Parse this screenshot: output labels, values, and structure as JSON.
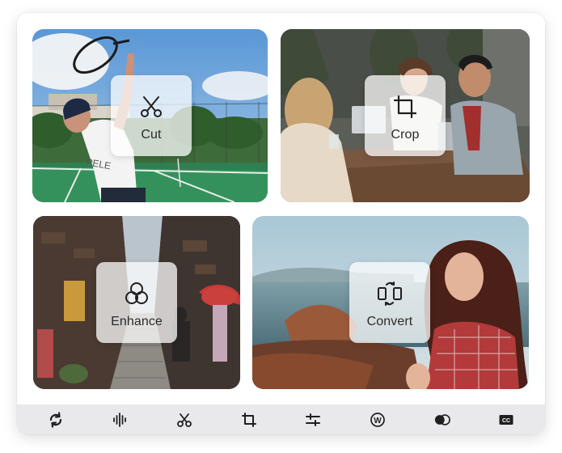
{
  "tools": [
    {
      "label": "Cut",
      "icon": "scissors-icon"
    },
    {
      "label": "Crop",
      "icon": "crop-icon"
    },
    {
      "label": "Enhance",
      "icon": "enhance-icon"
    },
    {
      "label": "Convert",
      "icon": "convert-icon"
    }
  ],
  "toolbar": {
    "items": [
      {
        "icon": "rotate-icon"
      },
      {
        "icon": "audio-waveform-icon"
      },
      {
        "icon": "scissors-icon"
      },
      {
        "icon": "crop-icon"
      },
      {
        "icon": "adjust-sliders-icon"
      },
      {
        "icon": "watermark-icon",
        "glyph": "W"
      },
      {
        "icon": "blend-icon"
      },
      {
        "icon": "subtitles-icon",
        "glyph": "CC"
      }
    ]
  },
  "colors": {
    "accent_text": "#2b2b2b",
    "toolbar_bg": "#e9e9ec",
    "icon": "#1f1f1f"
  }
}
